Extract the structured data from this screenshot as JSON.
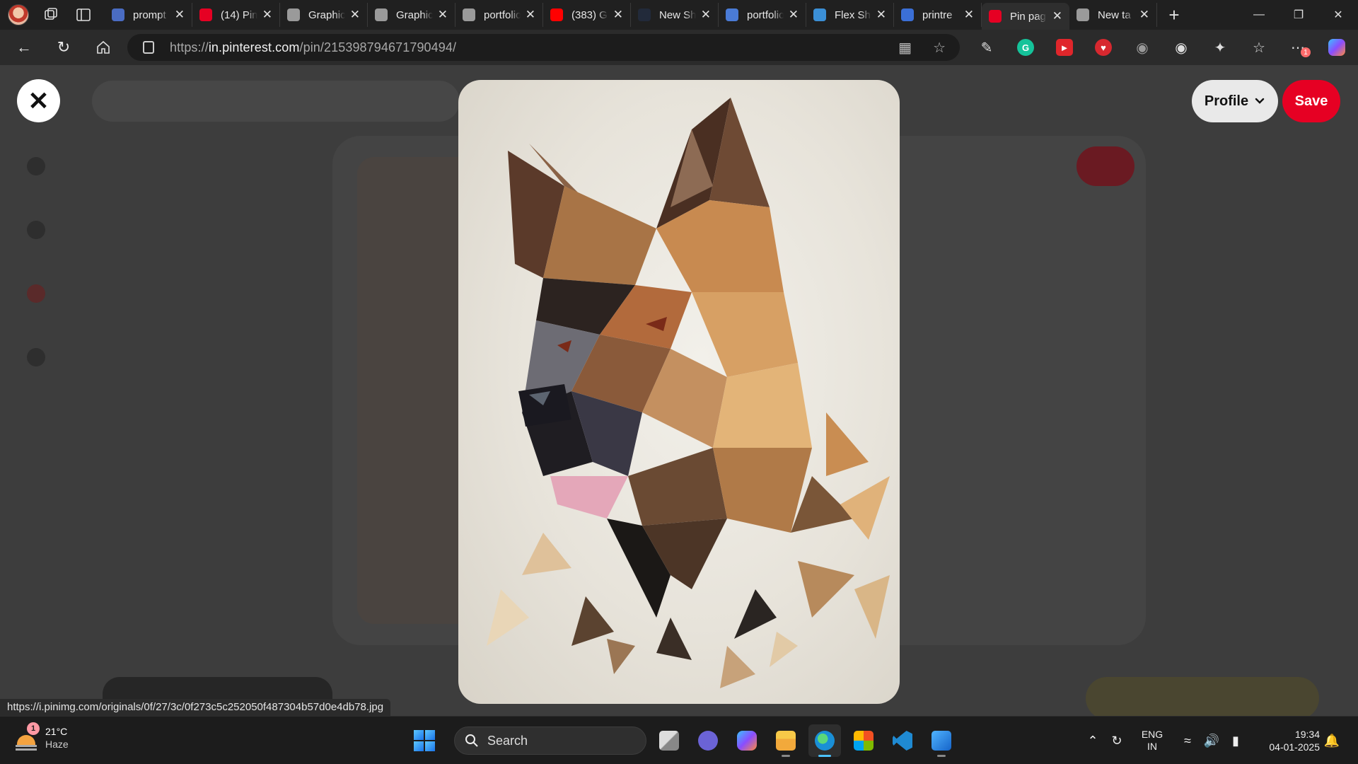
{
  "browser": {
    "tabs": [
      {
        "title": "prompt",
        "icon": "document-icon",
        "color": "#4a6cc3"
      },
      {
        "title": "(14) Pin",
        "icon": "pinterest-icon",
        "color": "#e60023"
      },
      {
        "title": "Graphic",
        "icon": "openai-icon",
        "color": "#9a9a9a"
      },
      {
        "title": "Graphic",
        "icon": "globe-icon",
        "color": "#9a9a9a"
      },
      {
        "title": "portfolio",
        "icon": "globe-icon",
        "color": "#9a9a9a"
      },
      {
        "title": "(383) G",
        "icon": "youtube-icon",
        "color": "#ff0000"
      },
      {
        "title": "New Sh",
        "icon": "dark-app-icon",
        "color": "#222a3a"
      },
      {
        "title": "portfolio",
        "icon": "feather-icon",
        "color": "#4a7bd6"
      },
      {
        "title": "Flex Sh",
        "icon": "wave-icon",
        "color": "#3b8fd6"
      },
      {
        "title": "printre",
        "icon": "search-icon",
        "color": "#3b6fd6"
      },
      {
        "title": "Pin pag",
        "icon": "pinterest-icon",
        "color": "#e60023",
        "active": true
      },
      {
        "title": "New ta",
        "icon": "newtab-icon",
        "color": "#9a9a9a"
      }
    ],
    "new_tab_label": "+",
    "url_prefix": "https://",
    "url_domain": "in.pinterest.com",
    "url_path": "/pin/215398794671790494/",
    "extension_badge": "1"
  },
  "pinterest": {
    "close_label": "✕",
    "profile_label": "Profile",
    "save_label": "Save",
    "image_alt": "Low-poly geometric German Shepherd dog portrait"
  },
  "status_url": "https://i.pinimg.com/originals/0f/27/3c/0f273c5c252050f487304b57d0e4db78.jpg",
  "taskbar": {
    "weather_badge": "1",
    "temperature": "21°C",
    "condition": "Haze",
    "search_label": "Search",
    "lang_top": "ENG",
    "lang_bottom": "IN",
    "time": "19:34",
    "date": "04-01-2025"
  },
  "colors": {
    "pinterest_red": "#e60023",
    "taskbar_bg": "#1c1c1c",
    "accent": "#4cc2ff"
  }
}
